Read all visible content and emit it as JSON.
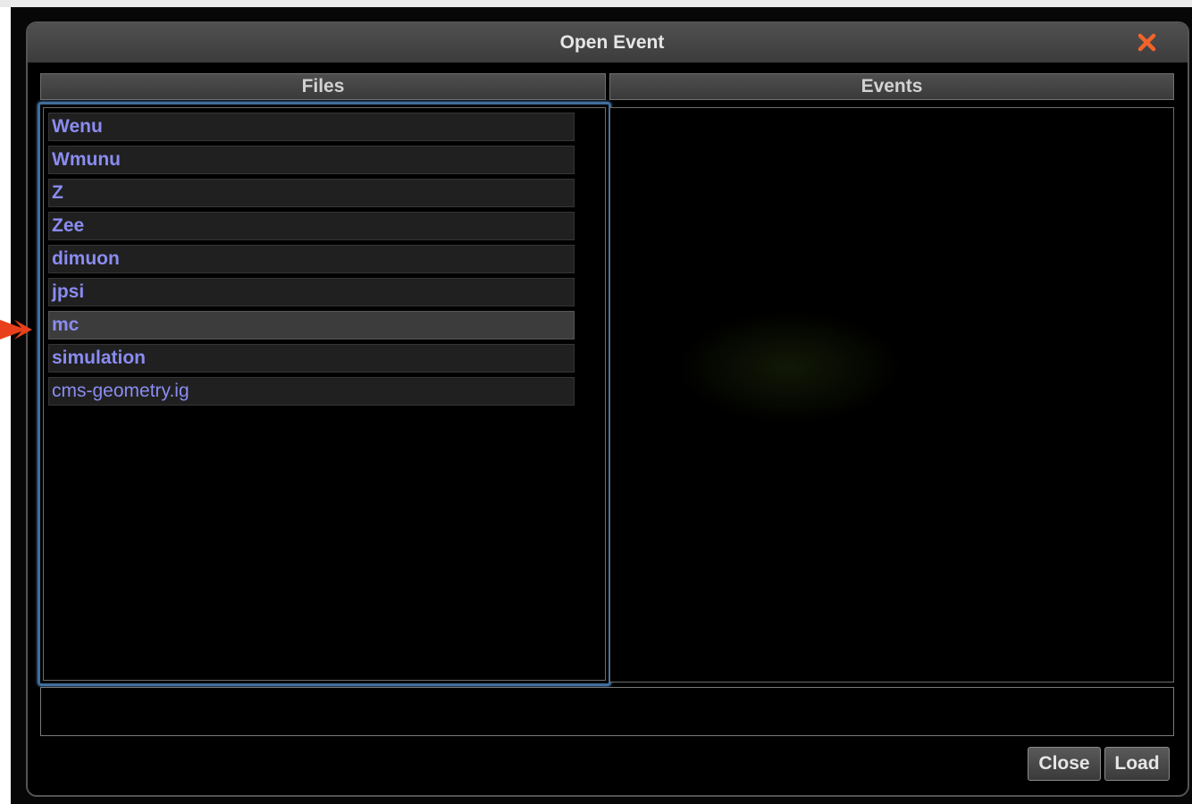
{
  "dialog": {
    "title": "Open Event",
    "close_icon": "close-x-icon"
  },
  "columns": {
    "files_label": "Files",
    "events_label": "Events"
  },
  "files": [
    {
      "label": "Wenu",
      "selected": false
    },
    {
      "label": "Wmunu",
      "selected": false
    },
    {
      "label": "Z",
      "selected": false
    },
    {
      "label": "Zee",
      "selected": false
    },
    {
      "label": "dimuon",
      "selected": false
    },
    {
      "label": "jpsi",
      "selected": false
    },
    {
      "label": "mc",
      "selected": true
    },
    {
      "label": "simulation",
      "selected": false
    },
    {
      "label": "cms-geometry.ig",
      "selected": false
    }
  ],
  "events": [],
  "status_text": "",
  "buttons": {
    "close_label": "Close",
    "load_label": "Load"
  },
  "colors": {
    "accent": "#f0642a",
    "file_text": "#8a8cf0",
    "focus_border": "#3f6e9c"
  }
}
